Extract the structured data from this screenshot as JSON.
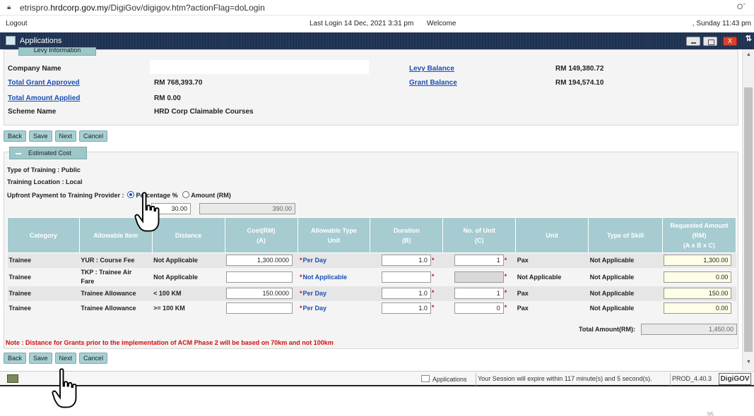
{
  "browser": {
    "url_prefix": "etrispro.",
    "url_domain": "hrdcorp.gov.my",
    "url_path": "/DigiGov/digigov.htm?actionFlag=doLogin",
    "key_icon": "key-icon",
    "lock_icon": "lock-icon"
  },
  "session": {
    "logout": "Logout",
    "last_login": "Last Login 14 Dec, 2021 3:31 pm",
    "welcome": "Welcome",
    "datetime": ", Sunday 11:43 pm"
  },
  "app": {
    "title": "Applications",
    "close_label": "X"
  },
  "levy": {
    "tab_label": "Levy Information",
    "company_name_label": "Company Name",
    "levy_balance_label": "Levy Balance",
    "levy_balance_value": "RM 149,380.72",
    "total_grant_approved_label": "Total Grant Approved",
    "total_grant_approved_value": "RM 768,393.70",
    "grant_balance_label": "Grant Balance",
    "grant_balance_value": "RM 194,574.10",
    "total_amount_applied_label": "Total Amount Applied",
    "total_amount_applied_value": "RM 0.00",
    "scheme_name_label": "Scheme Name",
    "scheme_name_value": "HRD Corp Claimable Courses"
  },
  "buttons": {
    "back": "Back",
    "save": "Save",
    "next": "Next",
    "cancel": "Cancel"
  },
  "estimated": {
    "tab_label": "Estimated Cost",
    "type_of_training": "Type of Training : Public",
    "training_location": "Training Location : Local",
    "upfront_label": "Upfront Payment to Training Provider :",
    "percentage_label": "Percentage %",
    "amount_label": "Amount (RM)",
    "percentage_value": "30.00",
    "amount_value": "390.00"
  },
  "table": {
    "headers": {
      "category": "Category",
      "allowable_item": "Allowable Item",
      "distance": "Distance",
      "cost_1": "Cost(RM)",
      "cost_2": "(A)",
      "type_unit_1": "Allowable Type",
      "type_unit_2": "Unit",
      "duration_1": "Duration",
      "duration_2": "(B)",
      "no_unit_1": "No. of Unit",
      "no_unit_2": "(C)",
      "unit": "Unit",
      "type_of_skill": "Type of Skill",
      "requested_1": "Requested Amount",
      "requested_2": "(RM)",
      "requested_3": "(A x B x C)"
    },
    "rows": [
      {
        "category": "Trainee",
        "item": "YUR : Course Fee",
        "distance": "Not Applicable",
        "cost": "1,300.0000",
        "type_unit": "Per Day",
        "duration": "1.0",
        "units": "1",
        "unit": "Pax",
        "skill": "Not Applicable",
        "requested": "1,300.00"
      },
      {
        "category": "Trainee",
        "item_1": "TKP : Trainee Air",
        "item_2": "Fare",
        "distance": "Not Applicable",
        "cost": "",
        "type_unit": "Not Applicable",
        "duration": "",
        "units": "",
        "unit": "Not Applicable",
        "skill": "Not Applicable",
        "requested": "0.00"
      },
      {
        "category": "Trainee",
        "item": "Trainee Allowance",
        "distance": "< 100 KM",
        "cost": "150.0000",
        "type_unit": "Per Day",
        "duration": "1.0",
        "units": "1",
        "unit": "Pax",
        "skill": "Not Applicable",
        "requested": "150.00"
      },
      {
        "category": "Trainee",
        "item": "Trainee Allowance",
        "distance": ">= 100 KM",
        "cost": "",
        "type_unit": "Per Day",
        "duration": "1.0",
        "units": "0",
        "unit": "Pax",
        "skill": "Not Applicable",
        "requested": "0.00"
      }
    ],
    "required_marker": "*",
    "total_label": "Total Amount(RM):",
    "total_value": "1,450.00"
  },
  "note": "Note : Distance for Grants prior to the implementation of ACM Phase 2 will be based on 70km and not 100km",
  "statusbar": {
    "applications": "Applications",
    "session_expire": "Your Session will expire within 117 minute(s) and 5 second(s).",
    "prod": "PROD_4.40.3",
    "brand": "DigiGOV"
  },
  "page_number": "35",
  "colors": {
    "header_bg": "#a6cbd1",
    "button_bg": "#a6d0d2",
    "app_bar": "#24395a",
    "link": "#1a4fb4",
    "required": "#d01010"
  }
}
